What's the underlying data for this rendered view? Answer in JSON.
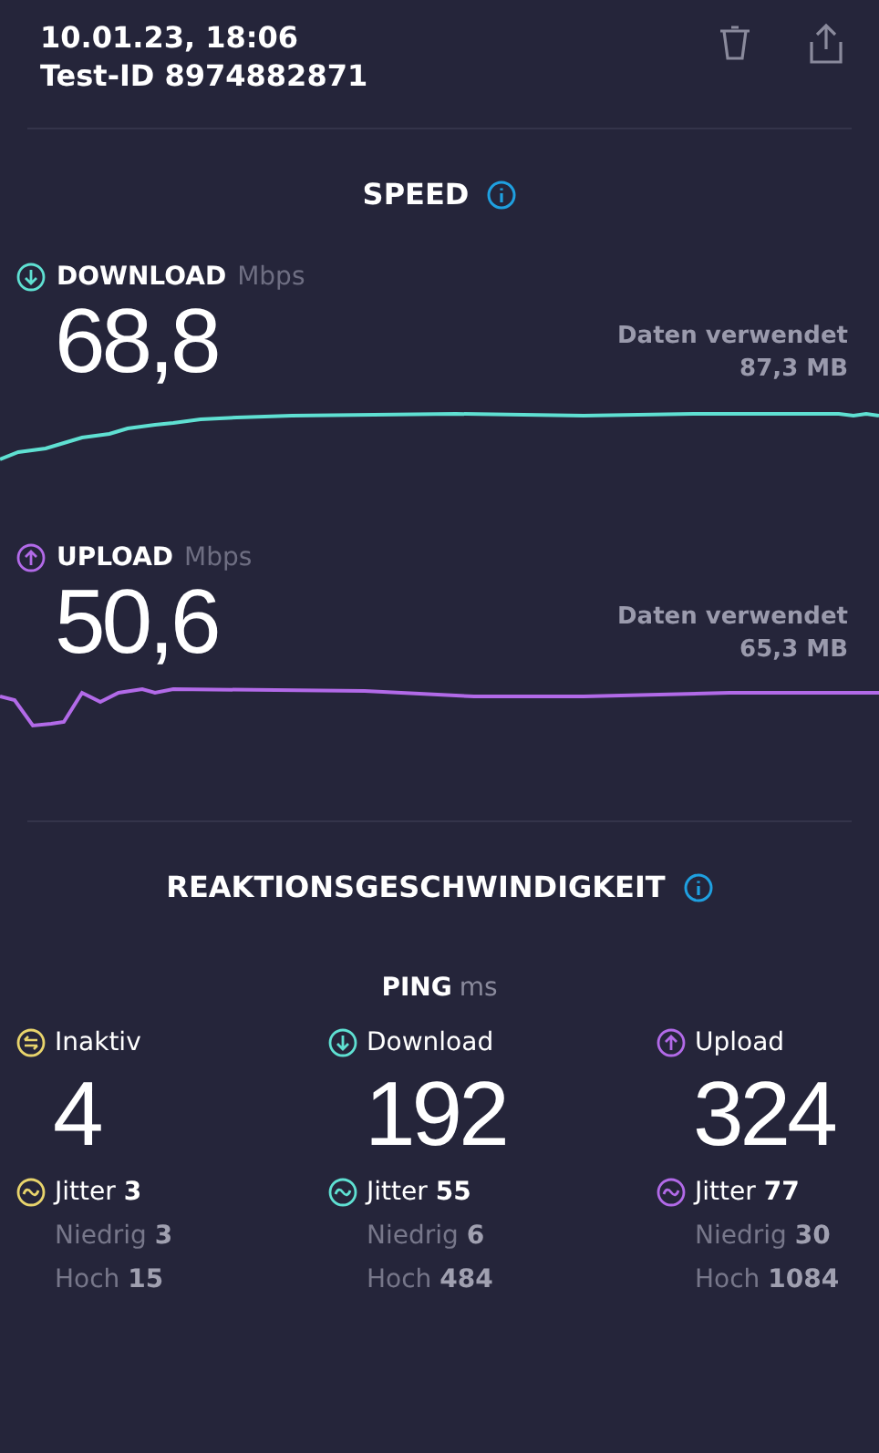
{
  "header": {
    "date": "10.01.23, 18:06",
    "test_id": "Test-ID 8974882871"
  },
  "speed": {
    "title": "SPEED",
    "tests": [
      {
        "kind": "download",
        "color": "#5fe0d2",
        "label": "DOWNLOAD",
        "unit": "Mbps",
        "value": "68,8",
        "data_label": "Daten verwendet",
        "data_value": "87,3 MB"
      },
      {
        "kind": "upload",
        "color": "#b26ae8",
        "label": "UPLOAD",
        "unit": "Mbps",
        "value": "50,6",
        "data_label": "Daten verwendet",
        "data_value": "65,3 MB"
      }
    ]
  },
  "responsiveness": {
    "title": "REAKTIONSGESCHWINDIGKEIT",
    "ping_label": "PING",
    "ping_unit": "ms",
    "columns": [
      {
        "kind": "idle",
        "color": "#e8d46c",
        "label": "Inaktiv",
        "value": "4",
        "jitter": "Jitter **3**",
        "low": "Niedrig **3**",
        "high": "Hoch **15**"
      },
      {
        "kind": "download",
        "color": "#5fe0d2",
        "label": "Download",
        "value": "192",
        "jitter": "Jitter **55**",
        "low": "Niedrig **6**",
        "high": "Hoch **484**"
      },
      {
        "kind": "upload",
        "color": "#b26ae8",
        "label": "Upload",
        "value": "324",
        "jitter": "Jitter **77**",
        "low": "Niedrig **30**",
        "high": "Hoch **1084**"
      }
    ]
  }
}
